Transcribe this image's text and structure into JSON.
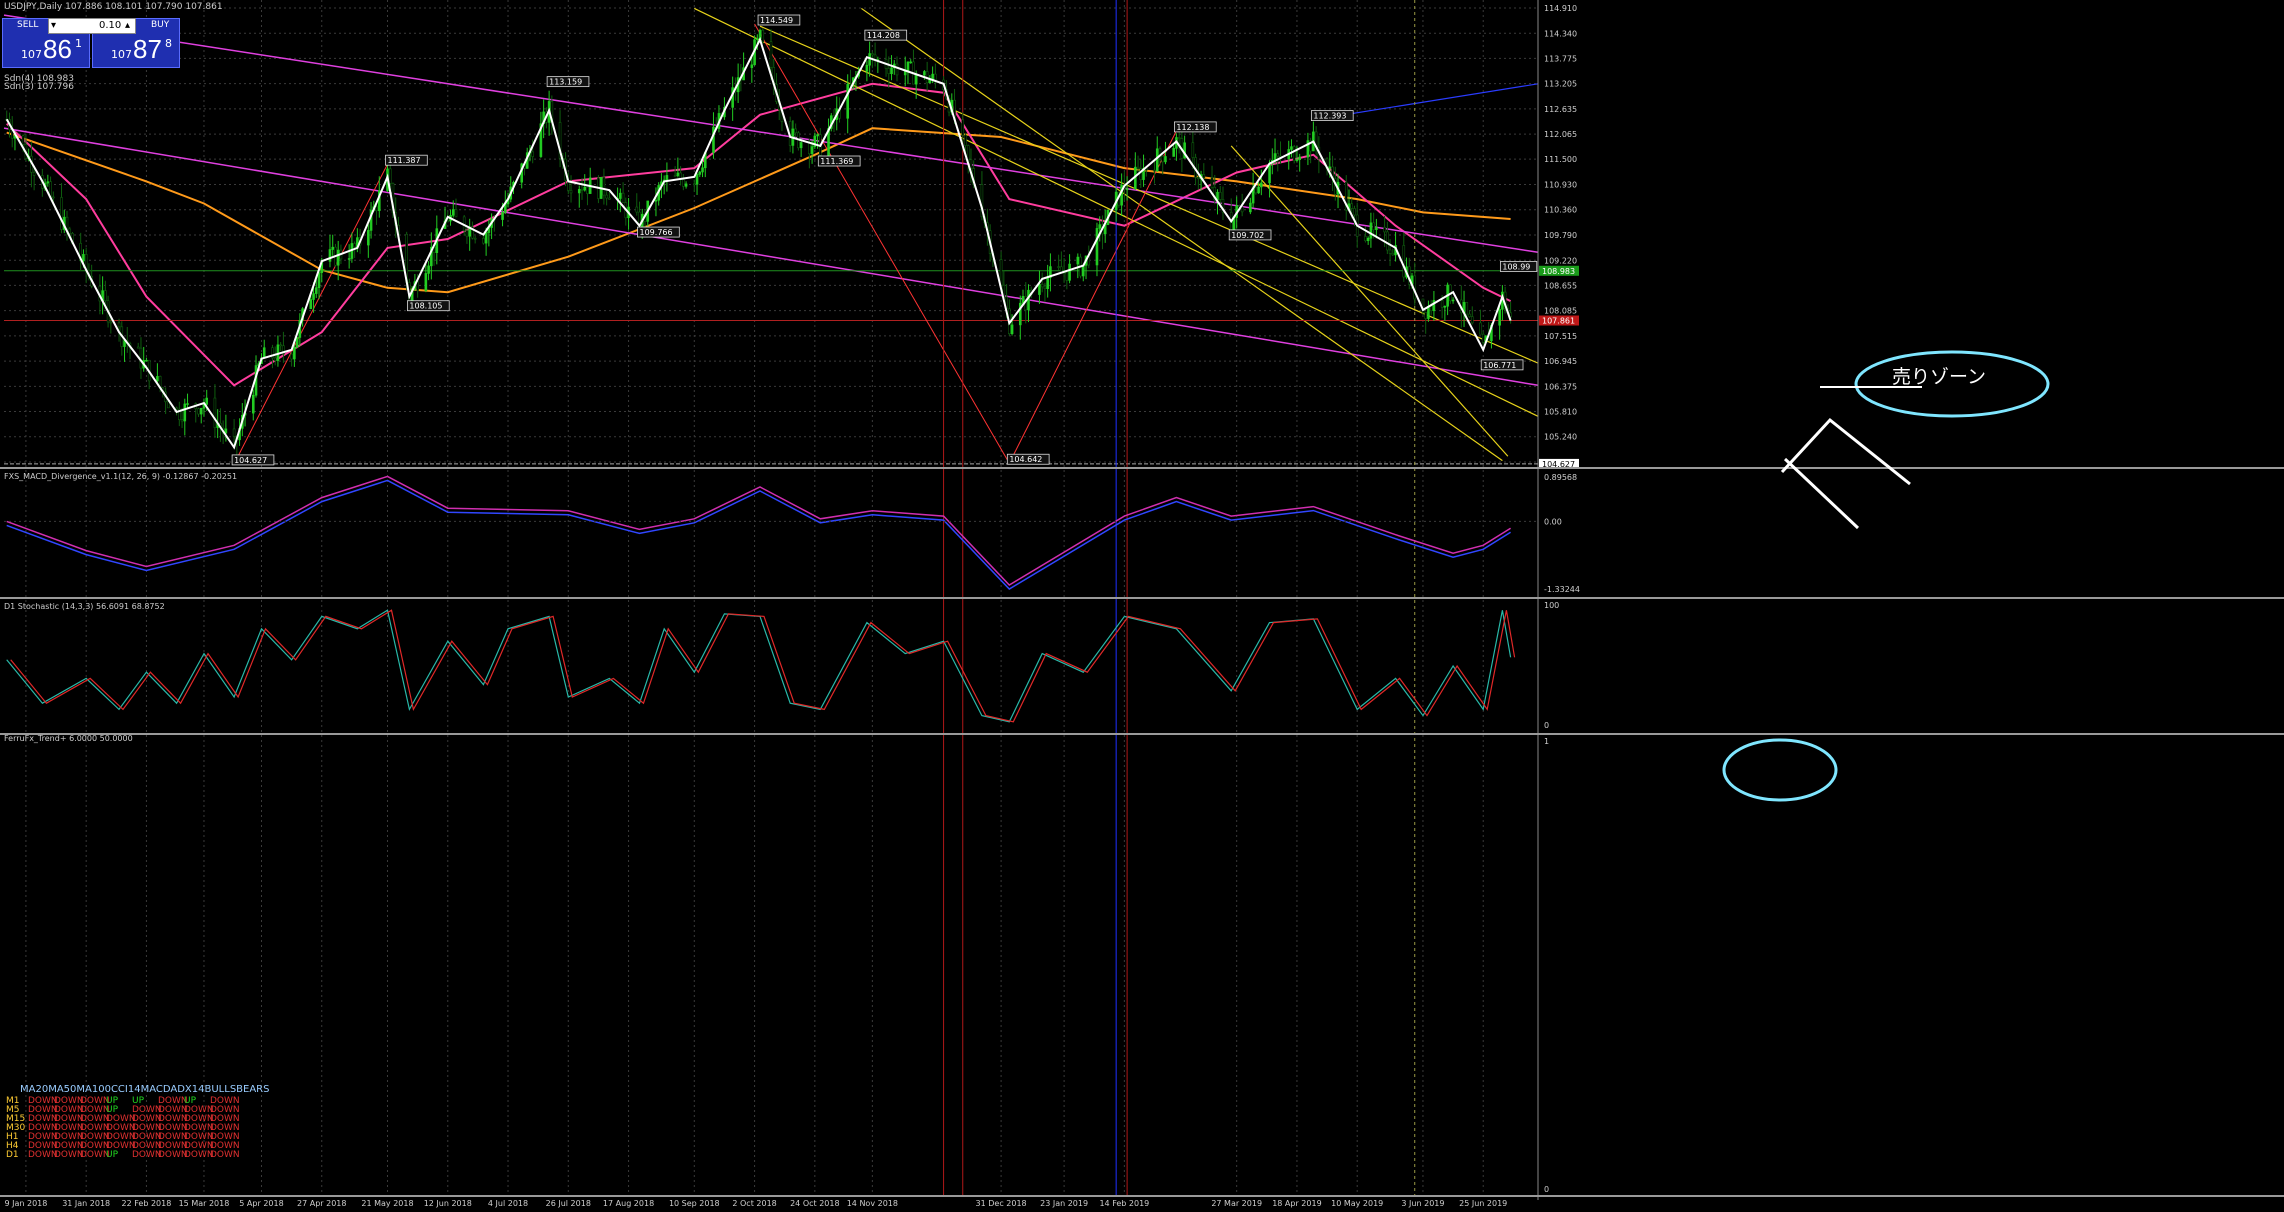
{
  "window": {
    "symbol_line": "USDJPY,Daily  107.886 108.101 107.790 107.861",
    "sdn_line1": "Sdn(4) 108.983",
    "sdn_line2": "Sdn(3) 107.796"
  },
  "trade_panel": {
    "sell_label": "SELL",
    "buy_label": "BUY",
    "lot_value": "0.10",
    "sell_price_prefix": "107",
    "sell_price_big": "86",
    "sell_price_sup": "1",
    "buy_price_prefix": "107",
    "buy_price_big": "87",
    "buy_price_sup": "8"
  },
  "annotation": {
    "sell_zone_label": "売りゾーン"
  },
  "indicators": {
    "macd_title": "FXS_MACD_Divergence_v1.1(12, 26, 9) -0.12867 -0.20251",
    "stoch_title": "D1 Stochastic (14,3,3) 56.6091 68.8752",
    "ferru_title": "FerruFx_Trend+ 6.0000 50.0000",
    "macd_axis": [
      "0.89568",
      "0.00",
      "-1.33244"
    ],
    "stoch_axis": [
      "100",
      "0"
    ],
    "ferru_axis": [
      "1",
      "0"
    ]
  },
  "trend_table": {
    "columns": [
      "MA20",
      "MA50",
      "MA100",
      "CCI14",
      "MACD",
      "ADX14",
      "BULLS",
      "BEARS"
    ],
    "rows": [
      {
        "tf": "M1",
        "cells": [
          "DOWN",
          "DOWN",
          "DOWN",
          "UP",
          "UP",
          "DOWN",
          "UP",
          "DOWN"
        ]
      },
      {
        "tf": "M5",
        "cells": [
          "DOWN",
          "DOWN",
          "DOWN",
          "UP",
          "DOWN",
          "DOWN",
          "DOWN",
          "DOWN"
        ]
      },
      {
        "tf": "M15",
        "cells": [
          "DOWN",
          "DOWN",
          "DOWN",
          "DOWN",
          "DOWN",
          "DOWN",
          "DOWN",
          "DOWN"
        ]
      },
      {
        "tf": "M30",
        "cells": [
          "DOWN",
          "DOWN",
          "DOWN",
          "DOWN",
          "DOWN",
          "DOWN",
          "DOWN",
          "DOWN"
        ]
      },
      {
        "tf": "H1",
        "cells": [
          "DOWN",
          "DOWN",
          "DOWN",
          "DOWN",
          "DOWN",
          "DOWN",
          "DOWN",
          "DOWN"
        ]
      },
      {
        "tf": "H4",
        "cells": [
          "DOWN",
          "DOWN",
          "DOWN",
          "DOWN",
          "DOWN",
          "DOWN",
          "DOWN",
          "DOWN"
        ]
      },
      {
        "tf": "D1",
        "cells": [
          "DOWN",
          "DOWN",
          "DOWN",
          "UP",
          "DOWN",
          "DOWN",
          "DOWN",
          "DOWN"
        ]
      }
    ]
  },
  "colors": {
    "background": "#000000",
    "grid": "#3a3a3a",
    "bull_candle": "#22cc22",
    "price_line": "#ffffff",
    "ma_orange": "#ff9a1a",
    "ma_pink": "#ff3d9e",
    "trend_magenta": "#e040e0",
    "channel_yellow": "#e6d21a",
    "zigzag_blue": "#4a7cff",
    "zigzag_red": "#ff3333",
    "cyan": "#7fe6ff",
    "up_text": "#21d921",
    "down_text": "#e03030"
  },
  "chart_data": {
    "type": "candlestick",
    "instrument": "USDJPY",
    "timeframe": "Daily",
    "price_axis_labels": [
      "114.910",
      "114.340",
      "113.775",
      "113.205",
      "112.635",
      "112.065",
      "111.500",
      "110.930",
      "110.360",
      "109.790",
      "109.220",
      "108.655",
      "108.085",
      "107.515",
      "106.945",
      "106.375",
      "105.810",
      "105.240",
      "104.670"
    ],
    "price_markers": {
      "current_bid": "107.861",
      "upper_green": "108.983",
      "lower": "104.627"
    },
    "x_tick_labels": [
      "9 Jan 2018",
      "31 Jan 2018",
      "22 Feb 2018",
      "15 Mar 2018",
      "5 Apr 2018",
      "27 Apr 2018",
      "21 May 2018",
      "12 Jun 2018",
      "4 Jul 2018",
      "26 Jul 2018",
      "17 Aug 2018",
      "10 Sep 2018",
      "2 Oct 2018",
      "24 Oct 2018",
      "14 Nov 2018",
      "31 Dec 2018",
      "23 Jan 2019",
      "14 Feb 2019",
      "27 Mar 2019",
      "18 Apr 2019",
      "10 May 2019",
      "3 Jun 2019",
      "25 Jun 2019"
    ],
    "pivot_labels": [
      {
        "date": "26 Mar 2018",
        "price": 104.627,
        "label": "104.627"
      },
      {
        "date": "21 May 2018",
        "price": 111.387,
        "label": "111.387"
      },
      {
        "date": "29 May 2018",
        "price": 108.105,
        "label": "108.105"
      },
      {
        "date": "19 Jul 2018",
        "price": 113.159,
        "label": "113.159"
      },
      {
        "date": "21 Aug 2018",
        "price": 109.766,
        "label": "109.766"
      },
      {
        "date": "4 Oct 2018",
        "price": 114.549,
        "label": "114.549"
      },
      {
        "date": "26 Oct 2018",
        "price": 111.369,
        "label": "111.369"
      },
      {
        "date": "12 Nov 2018",
        "price": 114.208,
        "label": "114.208"
      },
      {
        "date": "3 Jan 2019",
        "price": 104.642,
        "label": "104.642"
      },
      {
        "date": "5 Mar 2019",
        "price": 112.138,
        "label": "112.138"
      },
      {
        "date": "25 Mar 2019",
        "price": 109.702,
        "label": "109.702"
      },
      {
        "date": "24 Apr 2019",
        "price": 112.393,
        "label": "112.393"
      },
      {
        "date": "25 Jun 2019",
        "price": 106.771,
        "label": "106.771"
      },
      {
        "date": "2 Jul 2019",
        "price": 108.99,
        "label": "108.99"
      }
    ],
    "close_path": [
      {
        "x": "2 Jan 2018",
        "y": 112.4
      },
      {
        "x": "15 Jan 2018",
        "y": 111.0
      },
      {
        "x": "31 Jan 2018",
        "y": 109.0
      },
      {
        "x": "12 Feb 2018",
        "y": 107.6
      },
      {
        "x": "22 Feb 2018",
        "y": 106.8
      },
      {
        "x": "5 Mar 2018",
        "y": 105.8
      },
      {
        "x": "15 Mar 2018",
        "y": 106.0
      },
      {
        "x": "26 Mar 2018",
        "y": 105.0
      },
      {
        "x": "5 Apr 2018",
        "y": 107.0
      },
      {
        "x": "16 Apr 2018",
        "y": 107.2
      },
      {
        "x": "27 Apr 2018",
        "y": 109.2
      },
      {
        "x": "10 May 2018",
        "y": 109.5
      },
      {
        "x": "21 May 2018",
        "y": 111.1
      },
      {
        "x": "29 May 2018",
        "y": 108.4
      },
      {
        "x": "12 Jun 2018",
        "y": 110.2
      },
      {
        "x": "25 Jun 2018",
        "y": 109.8
      },
      {
        "x": "4 Jul 2018",
        "y": 110.6
      },
      {
        "x": "19 Jul 2018",
        "y": 112.6
      },
      {
        "x": "26 Jul 2018",
        "y": 111.0
      },
      {
        "x": "10 Aug 2018",
        "y": 110.8
      },
      {
        "x": "21 Aug 2018",
        "y": 110.0
      },
      {
        "x": "30 Aug 2018",
        "y": 111.0
      },
      {
        "x": "10 Sep 2018",
        "y": 111.1
      },
      {
        "x": "21 Sep 2018",
        "y": 112.6
      },
      {
        "x": "4 Oct 2018",
        "y": 114.2
      },
      {
        "x": "15 Oct 2018",
        "y": 112.0
      },
      {
        "x": "26 Oct 2018",
        "y": 111.8
      },
      {
        "x": "12 Nov 2018",
        "y": 113.8
      },
      {
        "x": "26 Nov 2018",
        "y": 113.5
      },
      {
        "x": "10 Dec 2018",
        "y": 113.2
      },
      {
        "x": "24 Dec 2018",
        "y": 110.4
      },
      {
        "x": "3 Jan 2019",
        "y": 107.8
      },
      {
        "x": "15 Jan 2019",
        "y": 108.8
      },
      {
        "x": "30 Jan 2019",
        "y": 109.1
      },
      {
        "x": "14 Feb 2019",
        "y": 110.9
      },
      {
        "x": "5 Mar 2019",
        "y": 111.9
      },
      {
        "x": "25 Mar 2019",
        "y": 110.1
      },
      {
        "x": "8 Apr 2019",
        "y": 111.4
      },
      {
        "x": "24 Apr 2019",
        "y": 111.9
      },
      {
        "x": "10 May 2019",
        "y": 110.0
      },
      {
        "x": "24 May 2019",
        "y": 109.5
      },
      {
        "x": "3 Jun 2019",
        "y": 108.1
      },
      {
        "x": "14 Jun 2019",
        "y": 108.5
      },
      {
        "x": "25 Jun 2019",
        "y": 107.2
      },
      {
        "x": "2 Jul 2019",
        "y": 108.4
      },
      {
        "x": "5 Jul 2019",
        "y": 107.86
      }
    ],
    "orange_ma": [
      {
        "x": "2 Jan 2018",
        "y": 112.1
      },
      {
        "x": "22 Feb 2018",
        "y": 111.0
      },
      {
        "x": "15 Mar 2018",
        "y": 110.5
      },
      {
        "x": "27 Apr 2018",
        "y": 109.0
      },
      {
        "x": "21 May 2018",
        "y": 108.6
      },
      {
        "x": "12 Jun 2018",
        "y": 108.5
      },
      {
        "x": "26 Jul 2018",
        "y": 109.3
      },
      {
        "x": "10 Sep 2018",
        "y": 110.4
      },
      {
        "x": "24 Oct 2018",
        "y": 111.6
      },
      {
        "x": "14 Nov 2018",
        "y": 112.2
      },
      {
        "x": "31 Dec 2018",
        "y": 112.0
      },
      {
        "x": "14 Feb 2019",
        "y": 111.3
      },
      {
        "x": "27 Mar 2019",
        "y": 111.0
      },
      {
        "x": "10 May 2019",
        "y": 110.6
      },
      {
        "x": "3 Jun 2019",
        "y": 110.3
      },
      {
        "x": "5 Jul 2019",
        "y": 110.15
      }
    ],
    "pink_ma": [
      {
        "x": "2 Jan 2018",
        "y": 112.3
      },
      {
        "x": "31 Jan 2018",
        "y": 110.6
      },
      {
        "x": "22 Feb 2018",
        "y": 108.4
      },
      {
        "x": "26 Mar 2018",
        "y": 106.4
      },
      {
        "x": "27 Apr 2018",
        "y": 107.6
      },
      {
        "x": "21 May 2018",
        "y": 109.5
      },
      {
        "x": "12 Jun 2018",
        "y": 109.7
      },
      {
        "x": "26 Jul 2018",
        "y": 111.0
      },
      {
        "x": "10 Sep 2018",
        "y": 111.3
      },
      {
        "x": "4 Oct 2018",
        "y": 112.5
      },
      {
        "x": "14 Nov 2018",
        "y": 113.2
      },
      {
        "x": "10 Dec 2018",
        "y": 113.0
      },
      {
        "x": "3 Jan 2019",
        "y": 110.6
      },
      {
        "x": "14 Feb 2019",
        "y": 110.0
      },
      {
        "x": "27 Mar 2019",
        "y": 111.2
      },
      {
        "x": "24 Apr 2019",
        "y": 111.6
      },
      {
        "x": "24 May 2019",
        "y": 110.0
      },
      {
        "x": "25 Jun 2019",
        "y": 108.6
      },
      {
        "x": "5 Jul 2019",
        "y": 108.3
      }
    ],
    "macd": [
      {
        "x": "2 Jan 2018",
        "y": 0.0
      },
      {
        "x": "31 Jan 2018",
        "y": -0.55
      },
      {
        "x": "22 Feb 2018",
        "y": -0.85
      },
      {
        "x": "26 Mar 2018",
        "y": -0.45
      },
      {
        "x": "27 Apr 2018",
        "y": 0.45
      },
      {
        "x": "21 May 2018",
        "y": 0.85
      },
      {
        "x": "12 Jun 2018",
        "y": 0.25
      },
      {
        "x": "26 Jul 2018",
        "y": 0.2
      },
      {
        "x": "21 Aug 2018",
        "y": -0.15
      },
      {
        "x": "10 Sep 2018",
        "y": 0.05
      },
      {
        "x": "4 Oct 2018",
        "y": 0.65
      },
      {
        "x": "26 Oct 2018",
        "y": 0.05
      },
      {
        "x": "14 Nov 2018",
        "y": 0.2
      },
      {
        "x": "10 Dec 2018",
        "y": 0.1
      },
      {
        "x": "3 Jan 2019",
        "y": -1.2
      },
      {
        "x": "14 Feb 2019",
        "y": 0.1
      },
      {
        "x": "5 Mar 2019",
        "y": 0.45
      },
      {
        "x": "25 Mar 2019",
        "y": 0.1
      },
      {
        "x": "24 Apr 2019",
        "y": 0.28
      },
      {
        "x": "24 May 2019",
        "y": -0.25
      },
      {
        "x": "14 Jun 2019",
        "y": -0.6
      },
      {
        "x": "25 Jun 2019",
        "y": -0.45
      },
      {
        "x": "5 Jul 2019",
        "y": -0.13
      }
    ],
    "stochastic": [
      {
        "x": "2 Jan 2018",
        "y": 55
      },
      {
        "x": "15 Jan 2018",
        "y": 20
      },
      {
        "x": "31 Jan 2018",
        "y": 40
      },
      {
        "x": "12 Feb 2018",
        "y": 15
      },
      {
        "x": "22 Feb 2018",
        "y": 45
      },
      {
        "x": "5 Mar 2018",
        "y": 20
      },
      {
        "x": "15 Mar 2018",
        "y": 60
      },
      {
        "x": "26 Mar 2018",
        "y": 25
      },
      {
        "x": "5 Apr 2018",
        "y": 80
      },
      {
        "x": "16 Apr 2018",
        "y": 55
      },
      {
        "x": "27 Apr 2018",
        "y": 90
      },
      {
        "x": "10 May 2018",
        "y": 80
      },
      {
        "x": "21 May 2018",
        "y": 95
      },
      {
        "x": "29 May 2018",
        "y": 15
      },
      {
        "x": "12 Jun 2018",
        "y": 70
      },
      {
        "x": "25 Jun 2018",
        "y": 35
      },
      {
        "x": "4 Jul 2018",
        "y": 80
      },
      {
        "x": "19 Jul 2018",
        "y": 90
      },
      {
        "x": "26 Jul 2018",
        "y": 25
      },
      {
        "x": "10 Aug 2018",
        "y": 40
      },
      {
        "x": "21 Aug 2018",
        "y": 20
      },
      {
        "x": "30 Aug 2018",
        "y": 80
      },
      {
        "x": "10 Sep 2018",
        "y": 45
      },
      {
        "x": "21 Sep 2018",
        "y": 92
      },
      {
        "x": "4 Oct 2018",
        "y": 90
      },
      {
        "x": "15 Oct 2018",
        "y": 20
      },
      {
        "x": "26 Oct 2018",
        "y": 15
      },
      {
        "x": "12 Nov 2018",
        "y": 85
      },
      {
        "x": "26 Nov 2018",
        "y": 60
      },
      {
        "x": "10 Dec 2018",
        "y": 70
      },
      {
        "x": "24 Dec 2018",
        "y": 10
      },
      {
        "x": "3 Jan 2019",
        "y": 5
      },
      {
        "x": "15 Jan 2019",
        "y": 60
      },
      {
        "x": "30 Jan 2019",
        "y": 45
      },
      {
        "x": "14 Feb 2019",
        "y": 90
      },
      {
        "x": "5 Mar 2019",
        "y": 80
      },
      {
        "x": "25 Mar 2019",
        "y": 30
      },
      {
        "x": "8 Apr 2019",
        "y": 85
      },
      {
        "x": "24 Apr 2019",
        "y": 88
      },
      {
        "x": "10 May 2019",
        "y": 15
      },
      {
        "x": "24 May 2019",
        "y": 40
      },
      {
        "x": "3 Jun 2019",
        "y": 10
      },
      {
        "x": "14 Jun 2019",
        "y": 50
      },
      {
        "x": "25 Jun 2019",
        "y": 15
      },
      {
        "x": "2 Jul 2019",
        "y": 95
      },
      {
        "x": "5 Jul 2019",
        "y": 57
      }
    ]
  }
}
